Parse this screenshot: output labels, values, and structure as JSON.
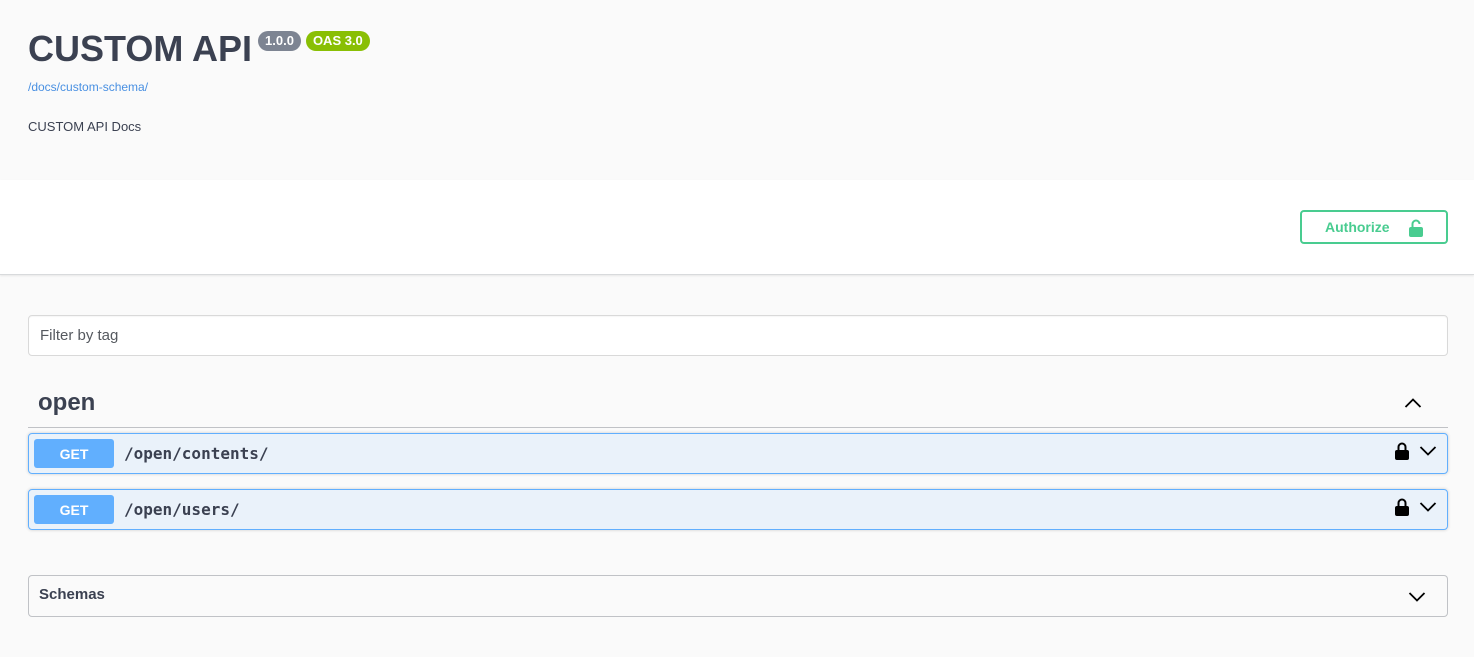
{
  "info": {
    "title": "CUSTOM API",
    "version": "1.0.0",
    "oas": "OAS 3.0",
    "schema_url": "/docs/custom-schema/",
    "description": "CUSTOM API Docs"
  },
  "auth": {
    "button_label": "Authorize",
    "icon": "unlocked-icon"
  },
  "filter": {
    "placeholder": "Filter by tag",
    "value": ""
  },
  "tags": [
    {
      "name": "open",
      "expanded": true,
      "operations": [
        {
          "method": "GET",
          "path": "/open/contents/",
          "locked": true
        },
        {
          "method": "GET",
          "path": "/open/users/",
          "locked": true
        }
      ]
    }
  ],
  "schemas": {
    "title": "Schemas",
    "expanded": false
  },
  "colors": {
    "text": "#3b4151",
    "get": "#61affe",
    "authorize": "#49cc90",
    "version_badge": "#7d8492",
    "oas_badge": "#89bf04",
    "link": "#4990e2"
  }
}
